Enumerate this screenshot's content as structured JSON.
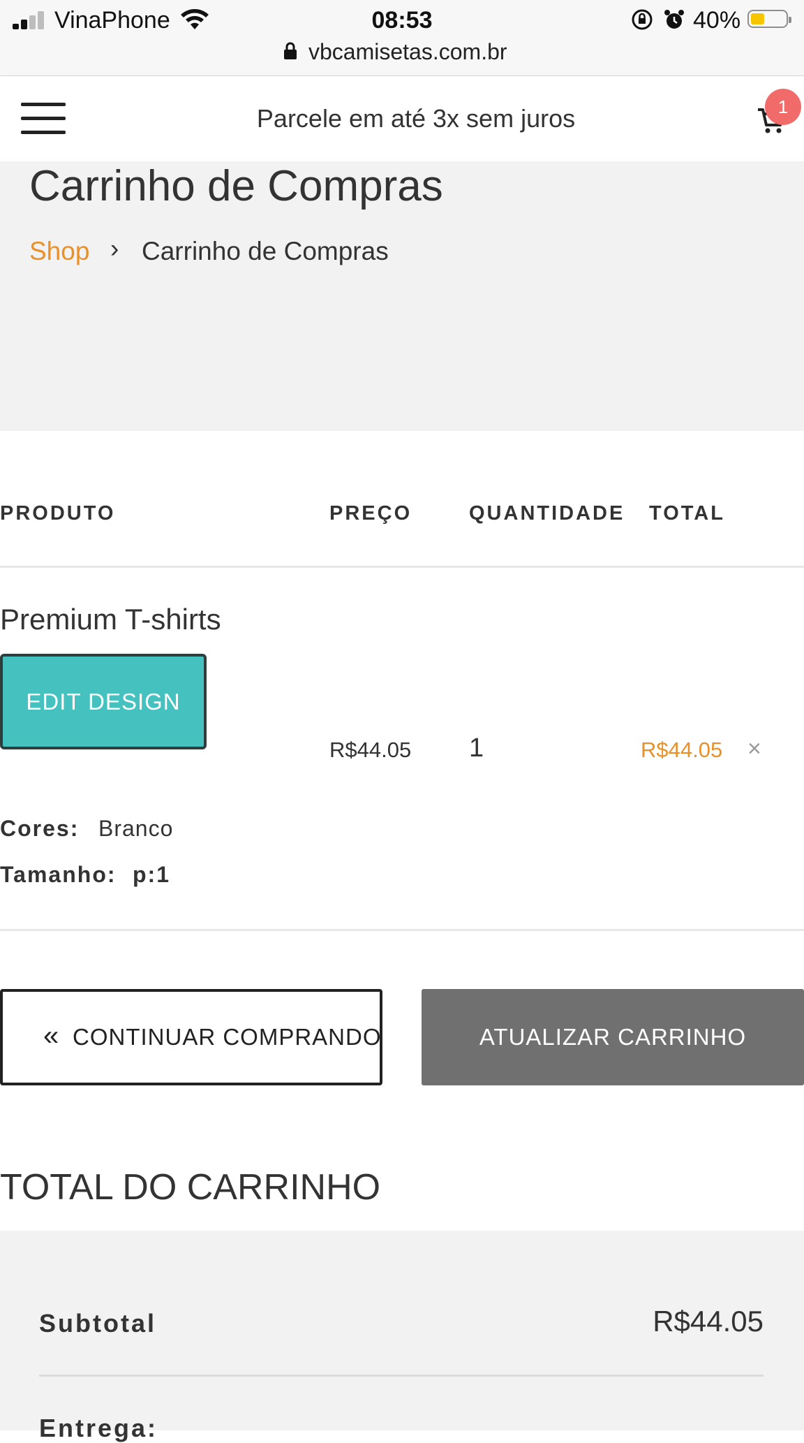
{
  "status_bar": {
    "carrier": "VinaPhone",
    "time": "08:53",
    "battery": "40%",
    "battery_level": 0.4,
    "url": "vbcamisetas.com.br"
  },
  "header": {
    "promo": "Parcele em até 3x sem juros",
    "cart_count": "1"
  },
  "page": {
    "title": "Carrinho de Compras",
    "breadcrumb": {
      "shop": "Shop",
      "separator": "›",
      "current": "Carrinho de Compras"
    }
  },
  "cart_table": {
    "headers": {
      "product": "PRODUTO",
      "price": "PREÇO",
      "quantity": "QUANTIDADE",
      "total": "TOTAL"
    },
    "item": {
      "name": "Premium T-shirts",
      "edit_button": "EDIT DESIGN",
      "price": "R$44.05",
      "quantity": "1",
      "total": "R$44.05",
      "remove": "×",
      "colors_label": "Cores:",
      "colors_value": "Branco",
      "size_label": "Tamanho:",
      "size_value": "p:1"
    }
  },
  "actions": {
    "continue_shopping": "CONTINUAR COMPRANDO",
    "update_cart": "ATUALIZAR CARRINHO"
  },
  "totals": {
    "title": "TOTAL DO CARRINHO",
    "subtotal_label": "Subtotal",
    "subtotal_value": "R$44.05",
    "shipping_label": "Entrega:"
  },
  "colors": {
    "accent_orange": "#e8912a",
    "edit_button_teal": "#45c1bf",
    "badge_red": "#f26b6b",
    "update_button_gray": "#707070"
  }
}
